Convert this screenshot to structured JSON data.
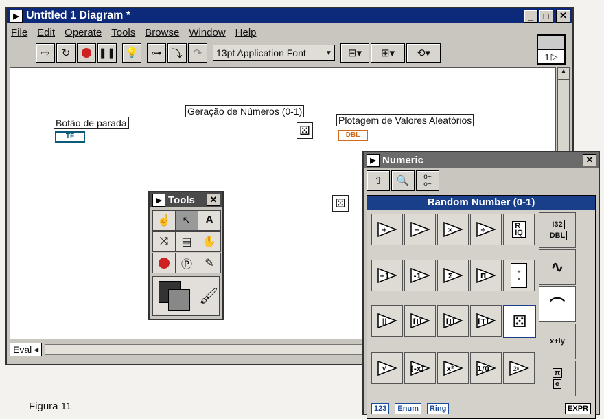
{
  "window": {
    "title": "Untitled 1 Diagram *",
    "icon": "vi-icon"
  },
  "menu": [
    "File",
    "Edit",
    "Operate",
    "Tools",
    "Browse",
    "Window",
    "Help"
  ],
  "toolbar": {
    "font_select": "13pt Application Font",
    "connector_label": "1"
  },
  "diagram": {
    "stop_label": "Botão de parada",
    "stop_terminal": "TF",
    "rng_label": "Geração de Números (0-1)",
    "plot_label": "Plotagem de Valores Aleatórios",
    "plot_terminal": "DBL"
  },
  "statusbar": {
    "eval": "Eval"
  },
  "tools_palette": {
    "title": "Tools"
  },
  "numeric_palette": {
    "title": "Numeric",
    "selected_item": "Random Number (0-1)",
    "ops": [
      [
        "+",
        "−",
        "×",
        "÷"
      ],
      [
        "+1",
        "-1",
        "Σ",
        "Π"
      ],
      [
        "||",
        "[I]",
        "[J]",
        "[T]"
      ],
      [
        "√",
        "[-x]",
        "x²",
        "1/0"
      ]
    ],
    "r_iq": "R\nIQ",
    "side": [
      "I32",
      "DBL",
      "x+iy",
      "π",
      "e"
    ],
    "const_123": "123",
    "const_enum": "Enum",
    "const_ring": "Ring",
    "const_expr": "EXPR"
  },
  "caption": "Figura 11",
  "colors": {
    "titlebar": "#0d2a7a",
    "boolean_terminal": "#0a5a7a",
    "dbl_terminal": "#d2691e"
  }
}
